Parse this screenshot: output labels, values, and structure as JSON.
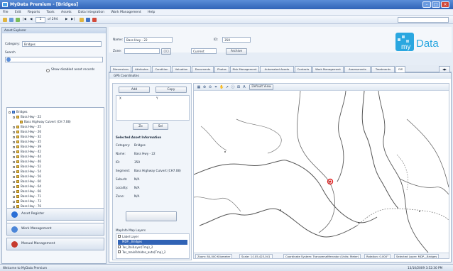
{
  "window": {
    "title": "MyData Premium - [Bridges]"
  },
  "menu": [
    "File",
    "Edit",
    "Reports",
    "Tools",
    "Assets",
    "Data Integration",
    "Work Management",
    "Help"
  ],
  "toolbar": {
    "record_pos": "1",
    "record_count": "of 294"
  },
  "asset_explorer": {
    "title": "Asset Explorer",
    "category_label": "Category:",
    "category_value": "Bridges",
    "search_label": "Search",
    "show_disabled_label": "Show disabled asset records",
    "tree_root": "Bridges",
    "tree_items": [
      "Bass Hwy - 22",
      "Bass Highway Culvert (CH 7.08)",
      "Bass Hwy - 25",
      "Bass Hwy - 26",
      "Bass Hwy - 32",
      "Bass Hwy - 35",
      "Bass Hwy - 39",
      "Bass Hwy - 42",
      "Bass Hwy - 44",
      "Bass Hwy - 46",
      "Bass Hwy - 52",
      "Bass Hwy - 54",
      "Bass Hwy - 56",
      "Bass Hwy - 60",
      "Bass Hwy - 64",
      "Bass Hwy - 66",
      "Bass Hwy - 71",
      "Bass Hwy - 73",
      "Bass Hwy - 76",
      "Bass Hwy - 79",
      "Bass Hwy - 82"
    ]
  },
  "nav": [
    {
      "label": "Asset Register",
      "color": "#2b6fd6"
    },
    {
      "label": "Work Management",
      "color": "#4c86d8"
    },
    {
      "label": "Manual Management",
      "color": "#c63a2e"
    }
  ],
  "form": {
    "name_label": "Name:",
    "name_value": "Bass Hwy - 22",
    "id_label": "ID:",
    "id_value": "350",
    "zone_label": "Zone:",
    "status_value": "Current",
    "archive_label": "Archive"
  },
  "tabs": [
    "Dimensions",
    "Attributes",
    "Condition",
    "Valuation",
    "Documents",
    "Photos",
    "Risk Management",
    "Automated Assets",
    "Contacts",
    "Work Management",
    "Assessments",
    "Treatments",
    "GIS"
  ],
  "active_tab": "GIS",
  "gps": {
    "title": "GPS Coordinates",
    "btn_add": "Add",
    "btn_copy": "Copy",
    "col_x": "X",
    "col_y": "Y",
    "btn_a": "Zo",
    "btn_b": "Sel",
    "selected_title": "Selected Asset Information",
    "category_label": "Category:",
    "category_value": "Bridges",
    "name_label": "Name:",
    "name_value": "Bass Hwy - 22",
    "id_label": "ID:",
    "id_value": "350",
    "segment_label": "Segment:",
    "segment_value": "Bass Highway Culvert (CH7.08)",
    "suburb_label": "Suburb:",
    "suburb_value": "N/A",
    "locality_label": "Locality:",
    "locality_value": "N/A",
    "zone_label": "Zone:",
    "zone_value": "N/A",
    "layers_title": "MapInfo Map Layers",
    "layers": [
      "Label Layer",
      "MDP__Bridges",
      "Tas_RailLayer(Tmp)_2",
      "Tas_mainRdsides_auto(Tmp)_2"
    ]
  },
  "map": {
    "default_view": "Default View",
    "status": [
      "Zoom: 84,000 Kilometer",
      "Scale: 1:105,423,041",
      "Coordinate System: TransverseMercator (Units: Meter)",
      "Rotation: 0.000°",
      "Selected Layer: MDP__Bridges"
    ]
  },
  "statusbar": {
    "left": "Welcome to MyData Premium",
    "right": "13/10/2009 3:52:30 PM"
  },
  "logo": {
    "text": "myData",
    "accent": "#2aa7e0"
  }
}
